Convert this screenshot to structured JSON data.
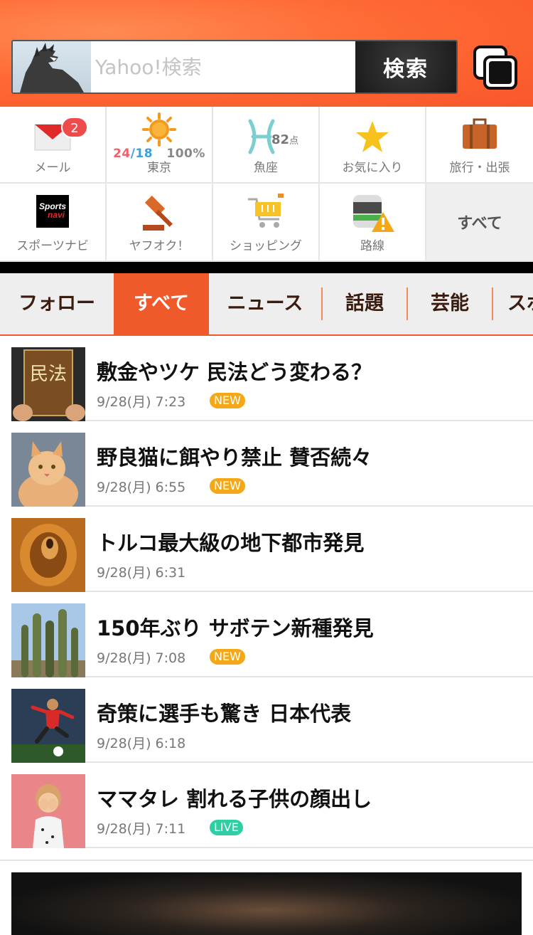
{
  "search": {
    "placeholder": "Yahoo!検索",
    "button_label": "検索"
  },
  "services": {
    "mail": {
      "label": "メール",
      "badge": "2",
      "icon": "mail-icon"
    },
    "weather": {
      "label": "東京",
      "high": "24",
      "slash": "/",
      "low": "18",
      "rain": "100%",
      "icon": "sun-icon"
    },
    "horoscope": {
      "label": "魚座",
      "score": "82",
      "score_unit": "点",
      "icon": "pisces-icon"
    },
    "favorites": {
      "label": "お気に入り",
      "icon": "star-icon"
    },
    "travel": {
      "label": "旅行・出張",
      "icon": "suitcase-icon"
    },
    "sports": {
      "label": "スポーツナビ",
      "icon": "sportsnavi-icon",
      "logo_text_1": "Sports",
      "logo_text_2": "navi"
    },
    "auction": {
      "label": "ヤフオク！",
      "icon": "gavel-icon"
    },
    "shopping": {
      "label": "ショッピング",
      "icon": "cart-icon"
    },
    "transit": {
      "label": "路線",
      "icon": "train-alert-icon"
    },
    "all": {
      "label": "すべて"
    }
  },
  "category_tabs": [
    {
      "label": "フォロー"
    },
    {
      "label": "すべて"
    },
    {
      "label": "ニュース"
    },
    {
      "label": "話題"
    },
    {
      "label": "芸能"
    },
    {
      "label": "スポ"
    }
  ],
  "news": [
    {
      "headline": "敷金やツケ 民法どう変わる？",
      "time": "9/28(月) 7:23",
      "tag": "NEW"
    },
    {
      "headline": "野良猫に餌やり禁止 賛否続々",
      "time": "9/28(月) 6:55",
      "tag": "NEW"
    },
    {
      "headline": "トルコ最大級の地下都市発見",
      "time": "9/28(月) 6:31",
      "tag": ""
    },
    {
      "headline": "150年ぶり サボテン新種発見",
      "time": "9/28(月) 7:08",
      "tag": "NEW"
    },
    {
      "headline": "奇策に選手も驚き 日本代表",
      "time": "9/28(月) 6:18",
      "tag": ""
    },
    {
      "headline": "ママタレ 割れる子供の顔出し",
      "time": "9/28(月) 7:11",
      "tag": "LIVE"
    }
  ],
  "thumb_text": {
    "book_title": "民法"
  },
  "colors": {
    "accent": "#f05a2a",
    "new_tag": "#f5a817",
    "live_tag": "#2ecfa4"
  }
}
